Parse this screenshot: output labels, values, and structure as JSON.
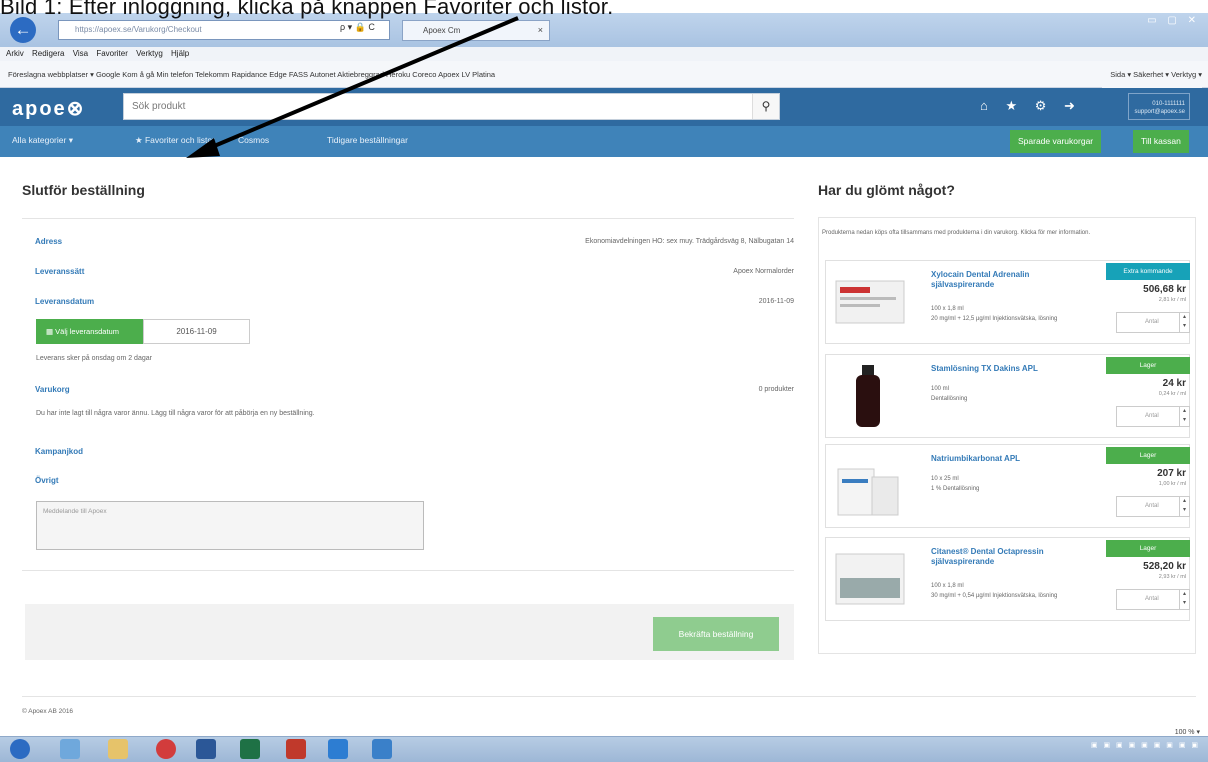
{
  "caption": "Bild 1: Efter inloggning, klicka på knappen Favoriter och listor.",
  "browser": {
    "address": "https://apoex.se/Varukorg/Checkout",
    "addr_tools": "ρ ▾ 🔒 C",
    "tab_title": "Apoex Cm",
    "menu": "Arkiv Redigera Visa Favoriter Verktyg Hjälp",
    "favorites": "Föreslagna webbplatser ▾   Google   Kom å gå   Min telefon   Telekomm   Rapidance   Edge   FASS   Autonet   Aktiebreggrad   Heroku   Coreco   Apoex   LV   Platina",
    "favorites_right": "Sida ▾  Säkerhet ▾  Verktyg ▾",
    "zoom": "100 % ▾"
  },
  "header": {
    "logo": "apoe⊗",
    "search_placeholder": "Sök produkt",
    "user_line1": "010-1111111",
    "user_line2": "support@apoex.se"
  },
  "nav": {
    "categories": "Alla kategorier ▾",
    "favorites": "★ Favoriter och listor",
    "coworkers": "Cosmos",
    "history": "Tidigare beställningar",
    "saved": "Sparade varukorgar",
    "cart": "Till kassan"
  },
  "checkout": {
    "title": "Slutför beställning",
    "address_label": "Adress",
    "address_value": "Ekonomiavdelningen HO: sex muy. Trädgårdsväg 8, Nälbugatan 14",
    "method_label": "Leveranssätt",
    "method_value": "Apoex Normalorder",
    "date_label": "Leveransdatum",
    "date_value": "2016-11-09",
    "date_button": "Välj leveransdatum",
    "date_field": "2016-11-09",
    "date_note": "Leverans sker på onsdag om 2 dagar",
    "cart_label": "Varukorg",
    "cart_value": "0 produkter",
    "cart_empty": "Du har inte lagt till några varor ännu. Lägg till några varor för att påbörja en ny beställning.",
    "campaign_label": "Kampanjkod",
    "other_label": "Övrigt",
    "comment_placeholder": "Meddelande till Apoex",
    "confirm_button": "Bekräfta beställning",
    "copyright": "© Apoex AB 2016"
  },
  "forgot": {
    "title": "Har du glömt något?",
    "intro": "Produkterna nedan köps ofta tillsammans med produkterna i din varukorg. Klicka för mer information.",
    "products": [
      {
        "name": "Xylocain Dental Adrenalin självaspirerande",
        "desc1": "100 x 1,8 ml",
        "desc2": "20 mg/ml + 12,5 µg/ml Injektionsvätska, lösning",
        "badge": "Extra kommande",
        "price": "506,68 kr",
        "unit": "2,81 kr / ml",
        "qty": "Antal"
      },
      {
        "name": "Stamlösning TX Dakins APL",
        "desc1": "100 ml",
        "desc2": "Dentallösning",
        "badge": "Lager",
        "price": "24 kr",
        "unit": "0,24 kr / ml",
        "qty": "Antal"
      },
      {
        "name": "Natriumbikarbonat APL",
        "desc1": "10 x 25 ml",
        "desc2": "1 % Dentallösning",
        "badge": "Lager",
        "price": "207 kr",
        "unit": "1,00 kr / ml",
        "qty": "Antal"
      },
      {
        "name": "Citanest® Dental Octapressin självaspirerande",
        "desc1": "100 x 1,8 ml",
        "desc2": "30 mg/ml + 0,54 µg/ml Injektionsvätska, lösning",
        "badge": "Lager",
        "price": "528,20 kr",
        "unit": "2,93 kr / ml",
        "qty": "Antal"
      }
    ]
  },
  "colors": {
    "brand": "#2f6aa0",
    "nav": "#3f83b9",
    "green": "#4cae4c",
    "teal": "#17a2b8"
  }
}
